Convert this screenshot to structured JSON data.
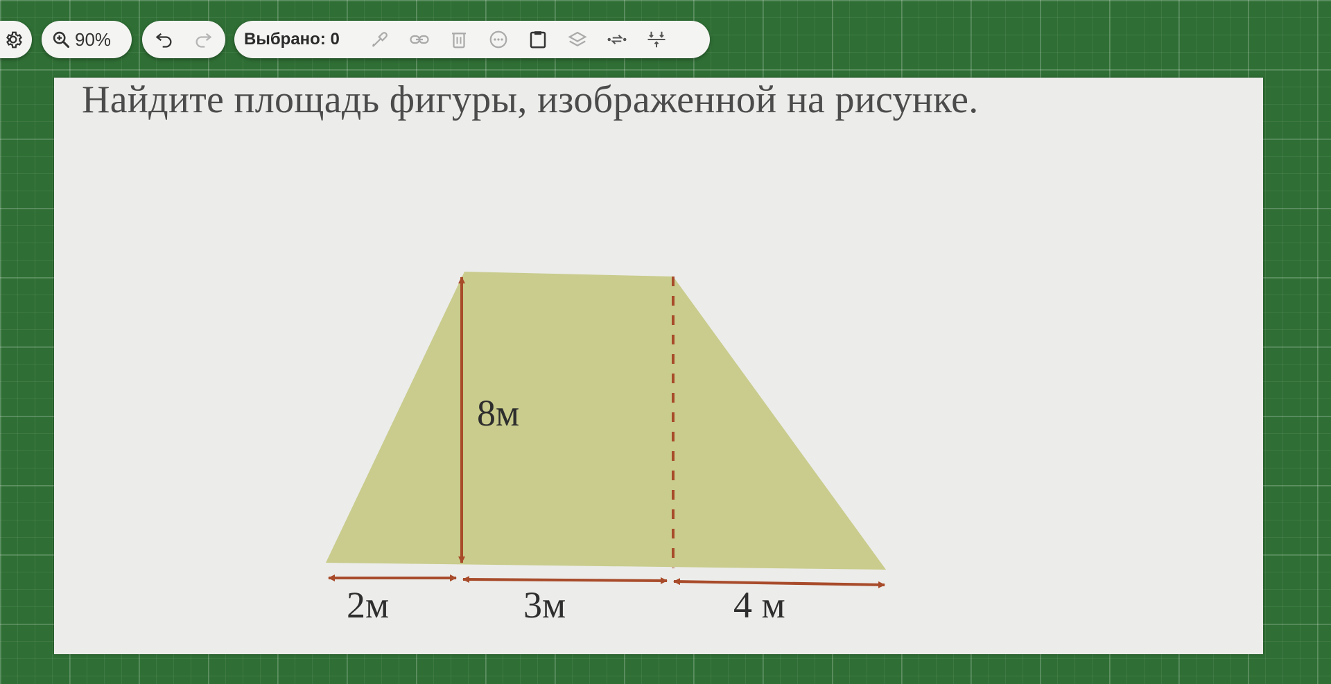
{
  "toolbar": {
    "settings_icon": "gear-icon",
    "zoom": {
      "icon": "zoom-in-icon",
      "value": "90%"
    },
    "history": {
      "undo_icon": "undo-icon",
      "redo_icon": "redo-icon"
    },
    "selection": {
      "label": "Выбрано: 0",
      "tools": [
        "eyedropper-icon",
        "link-icon",
        "trash-icon",
        "more-icon",
        "clipboard-icon",
        "layers-icon",
        "flip-icon",
        "align-icon"
      ]
    }
  },
  "slide": {
    "question": "Найдите площадь фигуры, изображенной на рисунке.",
    "figure": {
      "fill_color": "#c9cc8c",
      "line_color": "#a84b2a",
      "height_label": "8м",
      "left_label": "2м",
      "middle_label": "3м",
      "right_label": "4 м"
    }
  }
}
